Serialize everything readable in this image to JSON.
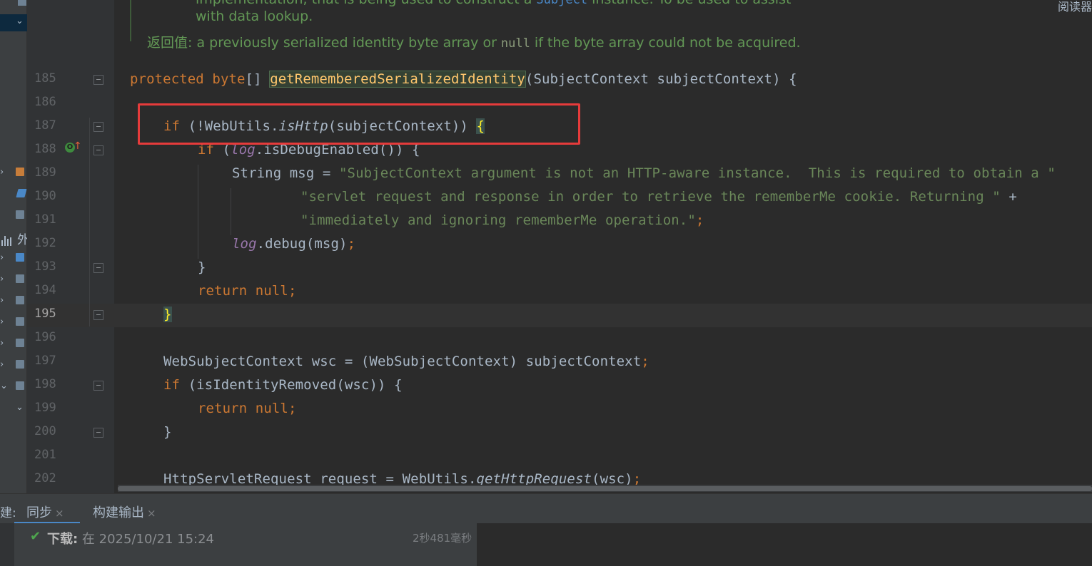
{
  "doc": {
    "line1_pre": "implementation, that is being used to construct a ",
    "line1_code": "Subject",
    "line1_post": " instance. To be used to assist",
    "line2": "with data lookup.",
    "return_label": "返回值:",
    "return_pre": " a previously serialized identity byte array or ",
    "return_null": "null",
    "return_post": " if the byte array could not be acquired."
  },
  "right_corner_label": "阅读器",
  "left_panel": {
    "label": "外"
  },
  "lines": [
    {
      "n": "185",
      "kw1": "protected",
      "kw2": "byte",
      "t1": "[] ",
      "method": "getRememberedSerializedIdentity",
      "t2": "(SubjectContext subjectContext) {"
    },
    {
      "n": "186"
    },
    {
      "n": "187",
      "kw": "if",
      "t1": " (!WebUtils.",
      "it": "isHttp",
      "t2": "(subjectContext)) ",
      "brace": "{"
    },
    {
      "n": "188",
      "kw": "if",
      "t1": " (",
      "fld": "log",
      "t2": ".isDebugEnabled()) {"
    },
    {
      "n": "189",
      "t1": "String msg = ",
      "str": "\"SubjectContext argument is not an HTTP-aware instance.  This is required to obtain a \"",
      "t2": " +"
    },
    {
      "n": "190",
      "str": "\"servlet request and response in order to retrieve the rememberMe cookie. Returning \"",
      "t2": " +"
    },
    {
      "n": "191",
      "str": "\"immediately and ignoring rememberMe operation.\"",
      "semi": ";"
    },
    {
      "n": "192",
      "fld": "log",
      "t1": ".debug(msg)",
      "semi": ";"
    },
    {
      "n": "193",
      "t1": "}"
    },
    {
      "n": "194",
      "kw": "return",
      "kw2": "null",
      "semi": ";"
    },
    {
      "n": "195",
      "brace": "}"
    },
    {
      "n": "196"
    },
    {
      "n": "197",
      "t1": "WebSubjectContext wsc = (WebSubjectContext) subjectContext",
      "semi": ";"
    },
    {
      "n": "198",
      "kw": "if",
      "t1": " (isIdentityRemoved(wsc)) {"
    },
    {
      "n": "199",
      "kw": "return",
      "kw2": "null",
      "semi": ";"
    },
    {
      "n": "200",
      "t1": "}"
    },
    {
      "n": "201"
    },
    {
      "n": "202",
      "t1": "HttpServletRequest request = WebUtils.",
      "it": "getHttpRequest",
      "t2": "(wsc)",
      "semi": ";"
    }
  ],
  "bottom": {
    "prefix": "建:",
    "tabs": [
      {
        "label": "同步",
        "close": "×"
      },
      {
        "label": "构建输出",
        "close": "×"
      }
    ],
    "status_check": "✔",
    "status_bold": "下载:",
    "status_text": " 在 2025/10/21 15:24",
    "duration": "2秒481毫秒"
  }
}
